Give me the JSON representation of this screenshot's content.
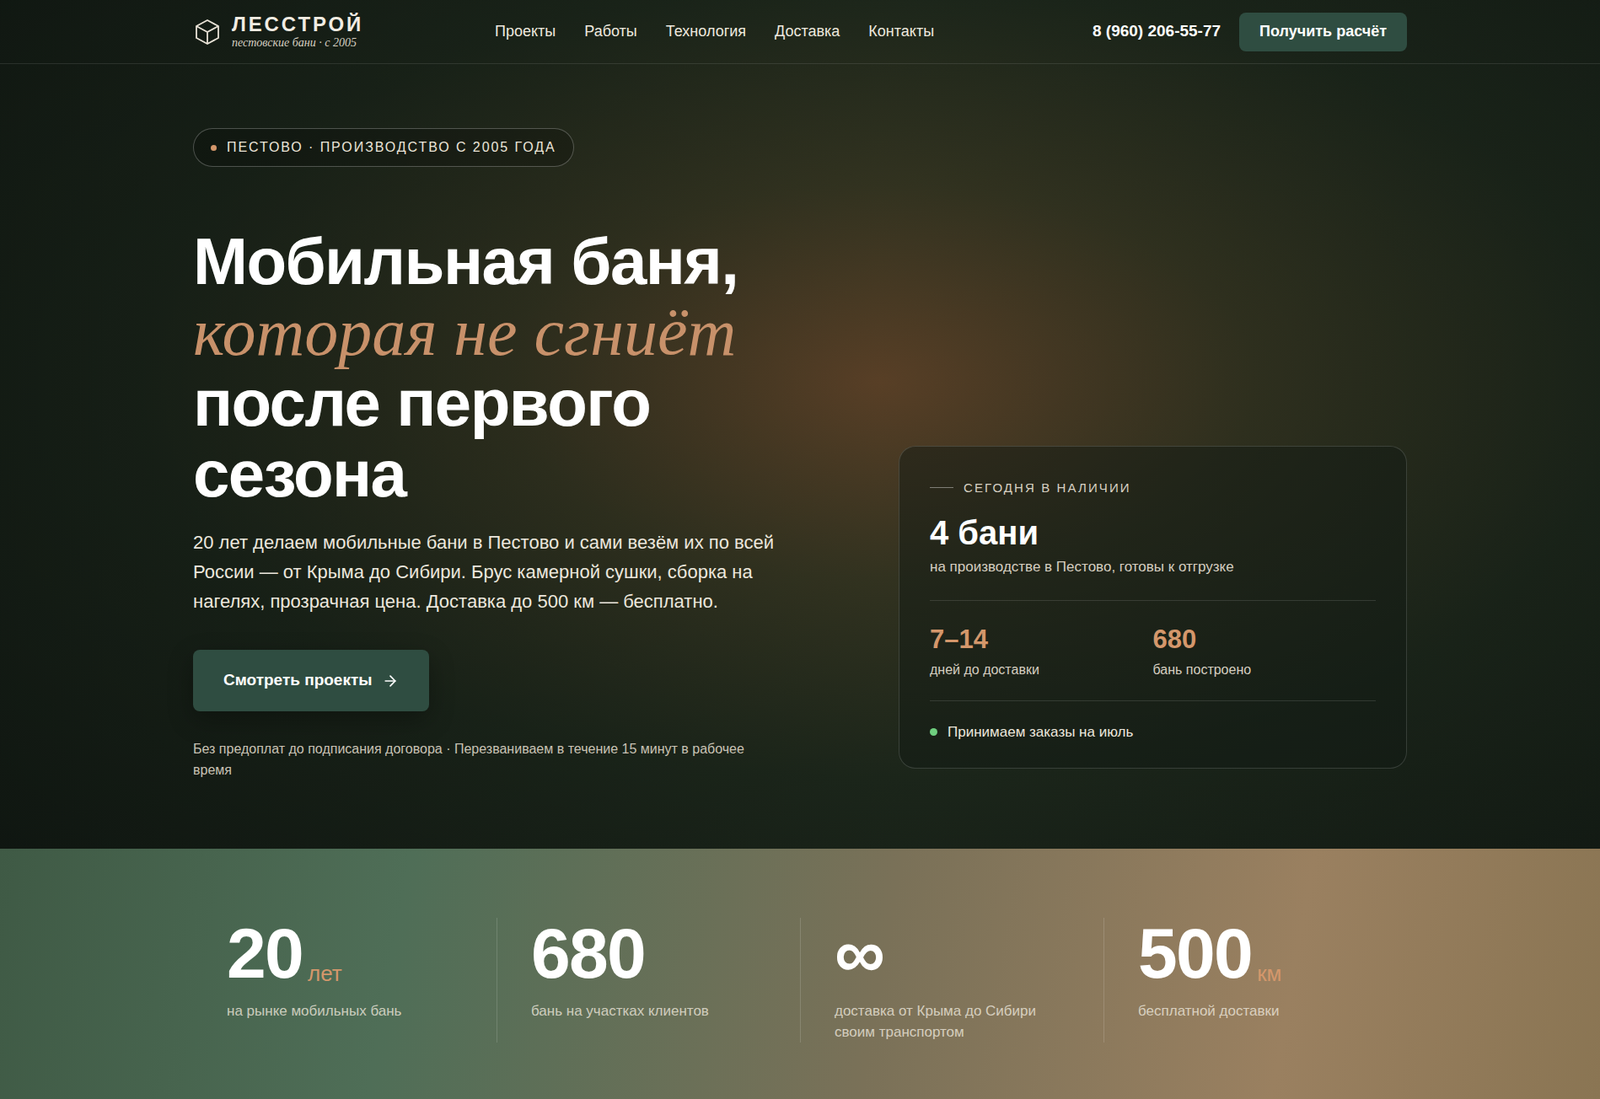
{
  "header": {
    "logo": {
      "name": "ЛЕССТРОЙ",
      "tagline": "пестовские бани · с 2005"
    },
    "nav": [
      "Проекты",
      "Работы",
      "Технология",
      "Доставка",
      "Контакты"
    ],
    "phone": "8 (960) 206-55-77",
    "cta": "Получить расчёт"
  },
  "hero": {
    "badge": "ПЕСТОВО · ПРОИЗВОДСТВО С 2005 ГОДА",
    "title": [
      {
        "text": "Мобильная баня,",
        "kind": "plain"
      },
      {
        "text": "которая не сгниёт",
        "kind": "accent"
      },
      {
        "text": "после первого",
        "kind": "plain"
      },
      {
        "text": "сезона",
        "kind": "plain"
      }
    ],
    "description": "20 лет делаем мобильные бани в Пестово и сами везём их по всей России — от Крыма до Сибири. Брус камерной сушки, сборка на нагелях, прозрачная цена. Доставка до 500 км — бесплатно.",
    "button": "Смотреть проекты",
    "note": "Без предоплат до подписания договора · Перезваниваем в течение 15 минут в рабочее время"
  },
  "card": {
    "label": "СЕГОДНЯ В НАЛИЧИИ",
    "value": "4 бани",
    "caption": "на производстве в Пестово, готовы к отгрузке",
    "stats": [
      {
        "value": "7–14",
        "label": "дней до доставки"
      },
      {
        "value": "680",
        "label": "бань построено"
      }
    ],
    "status": "Принимаем заказы на июль"
  },
  "stats": [
    {
      "value": "20",
      "unit": "лет",
      "label": "на рынке мобильных бань"
    },
    {
      "value": "680",
      "unit": "",
      "label": "бань на участках клиентов"
    },
    {
      "value": "∞",
      "unit": "",
      "label": "доставка от Крыма до Сибири своим транспортом"
    },
    {
      "value": "500",
      "unit": "км",
      "label": "бесплатной доставки"
    }
  ]
}
